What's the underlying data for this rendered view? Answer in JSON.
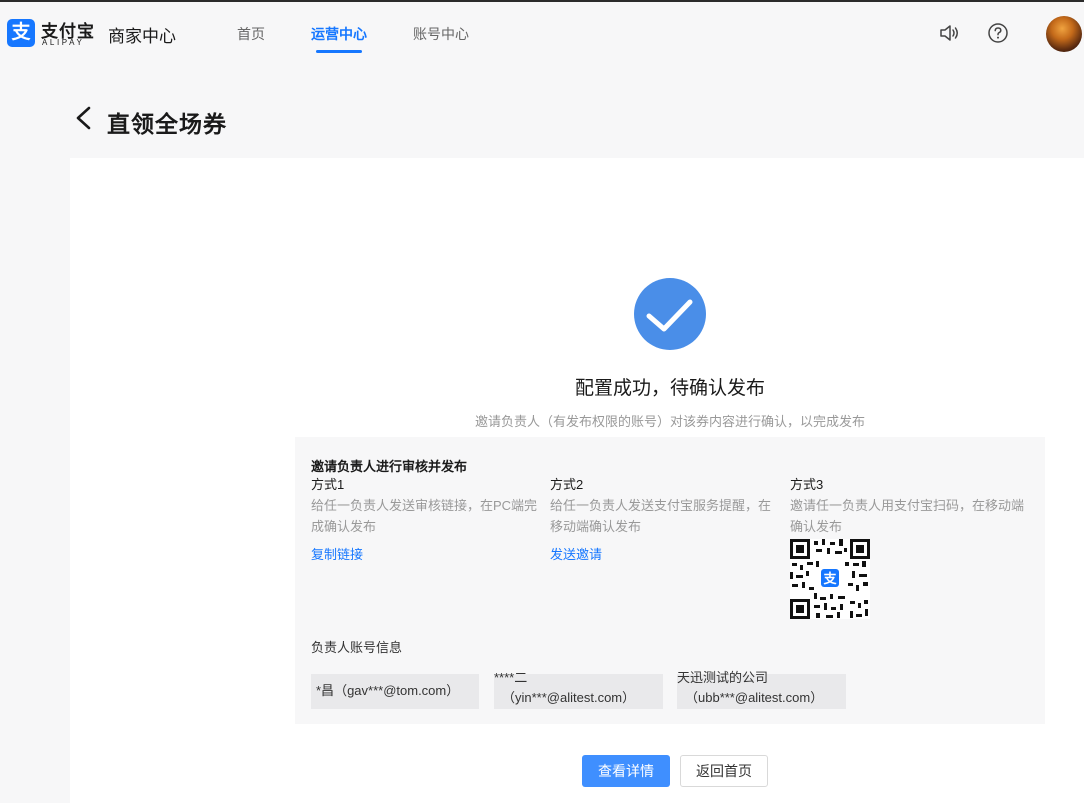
{
  "header": {
    "logo_cn": "支付宝",
    "logo_en": "ALIPAY",
    "logo_glyph": "支",
    "merchant_center": "商家中心",
    "nav": [
      {
        "label": "首页",
        "active": false
      },
      {
        "label": "运营中心",
        "active": true
      },
      {
        "label": "账号中心",
        "active": false
      }
    ],
    "icons": [
      "speaker-icon",
      "help-icon",
      "avatar"
    ],
    "accent_color": "#1677ff"
  },
  "page": {
    "title": "直领全场券"
  },
  "result": {
    "status": "success",
    "title": "配置成功，待确认发布",
    "subtitle": "邀请负责人（有发布权限的账号）对该券内容进行确认，以完成发布"
  },
  "invite": {
    "title": "邀请负责人进行审核并发布",
    "methods": [
      {
        "name": "方式1",
        "desc": "给任一负责人发送审核链接，在PC端完成确认发布",
        "action": "复制链接"
      },
      {
        "name": "方式2",
        "desc": "给任一负责人发送支付宝服务提醒，在移动端确认发布",
        "action": "发送邀请"
      },
      {
        "name": "方式3",
        "desc": "邀请任一负责人用支付宝扫码，在移动端确认发布",
        "action": ""
      }
    ],
    "qr_center_glyph": "支"
  },
  "accounts": {
    "title": "负责人账号信息",
    "items": [
      {
        "name": "*昌",
        "email": "（gav***@tom.com）"
      },
      {
        "name": "****二",
        "email": "（yin***@alitest.com）"
      },
      {
        "name": "天迅测试的公司",
        "email": "（ubb***@alitest.com）"
      }
    ]
  },
  "actions": {
    "primary": "查看详情",
    "secondary": "返回首页"
  }
}
